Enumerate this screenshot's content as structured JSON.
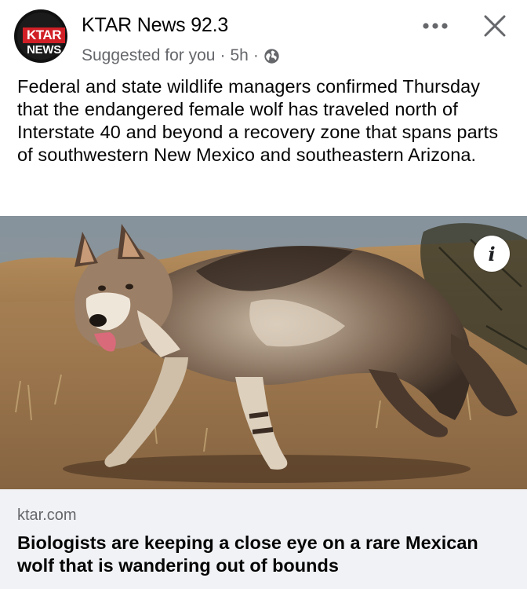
{
  "header": {
    "page_name": "KTAR News 92.3",
    "logo_top": "KTAR",
    "logo_bottom": "NEWS",
    "suggested": "Suggested for you",
    "sep1": "·",
    "time": "5h",
    "sep2": "·",
    "audience_icon": "globe-icon",
    "more_icon": "more-horizontal-icon",
    "close_icon": "close-icon"
  },
  "post": {
    "text": "Federal and state wildlife managers confirmed Thursday that the endangered female wolf has traveled north of Interstate 40 and beyond a recovery zone that spans parts of southwestern New Mexico and southeastern Arizona."
  },
  "media": {
    "info_glyph": "i"
  },
  "link": {
    "domain": "ktar.com",
    "title": "Biologists are keeping a close eye on a rare Mexican wolf that is wandering out of bounds"
  },
  "colors": {
    "brand_red": "#d11f26",
    "secondary_text": "#65676b",
    "card_bg": "#f0f2f5"
  }
}
